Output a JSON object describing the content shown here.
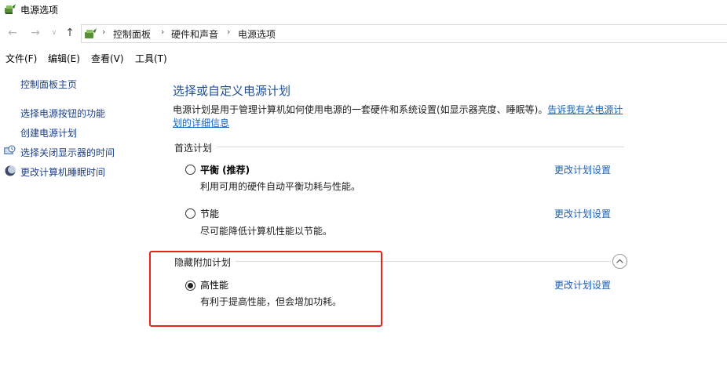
{
  "window": {
    "title": "电源选项"
  },
  "address": {
    "breadcrumbs": [
      "控制面板",
      "硬件和声音",
      "电源选项"
    ]
  },
  "menu": {
    "items": [
      "文件(F)",
      "编辑(E)",
      "查看(V)",
      "工具(T)"
    ]
  },
  "sidebar": {
    "home": "控制面板主页",
    "links": [
      "选择电源按钮的功能",
      "创建电源计划",
      "选择关闭显示器的时间",
      "更改计算机睡眠时间"
    ]
  },
  "main": {
    "title": "选择或自定义电源计划",
    "description": "电源计划是用于管理计算机如何使用电源的一套硬件和系统设置(如显示器亮度、睡眠等)。",
    "description_link": "告诉我有关电源计划的详细信息",
    "preferred_group": "首选计划",
    "hidden_group": "隐藏附加计划",
    "change_settings_label": "更改计划设置",
    "plans": [
      {
        "name": "平衡 (推荐)",
        "desc": "利用可用的硬件自动平衡功耗与性能。",
        "selected": false
      },
      {
        "name": "节能",
        "desc": "尽可能降低计算机性能以节能。",
        "selected": false
      },
      {
        "name": "高性能",
        "desc": "有利于提高性能，但会增加功耗。",
        "selected": true
      }
    ]
  },
  "colors": {
    "link": "#1d3f87",
    "title": "#1e4f9c",
    "highlight": "#e8231c"
  }
}
